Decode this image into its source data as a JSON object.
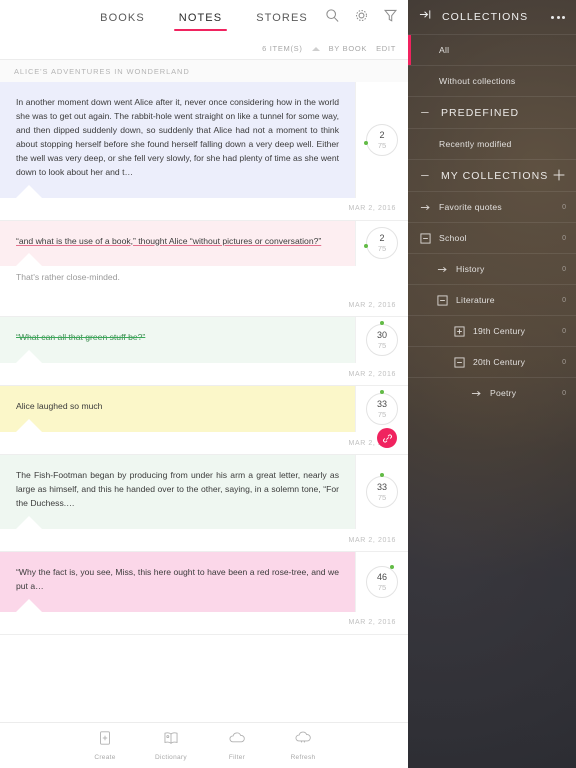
{
  "topnav": {
    "tabs": [
      {
        "label": "BOOKS",
        "active": false
      },
      {
        "label": "NOTES",
        "active": true
      },
      {
        "label": "STORES",
        "active": false
      }
    ],
    "icons": [
      "search-icon",
      "gear-icon",
      "filter-icon"
    ]
  },
  "subbar": {
    "count_label": "6 ITEM(S)",
    "sort_label": "BY BOOK",
    "edit_label": "EDIT"
  },
  "list": {
    "book_title": "ALICE'S ADVENTURES IN WONDERLAND",
    "notes": [
      {
        "text": "In another moment down went Alice after it, never once considering how in the world she was to get out again. The rabbit-hole went straight on like a tunnel for some way, and then dipped suddenly down, so suddenly that Alice had not a moment to think about stopping herself before she found herself falling down a very deep well. Either the well was very deep, or she fell very slowly, for she had plenty of time as she went down to look about her and t…",
        "style": "plain",
        "bg": "#eceefb",
        "accent": "#2b4fd8",
        "page": "2",
        "total": "75",
        "dot": "pos-left",
        "date": "MAR 2, 2016",
        "comment": null,
        "link": false
      },
      {
        "text": "“and what is the use of a book,” thought Alice “without pictures or conversation?”",
        "style": "underline",
        "bg": "#fdeef1",
        "accent": "",
        "page": "2",
        "total": "75",
        "dot": "pos-left",
        "date": "MAR 2, 2016",
        "comment": "That's rather close-minded.",
        "link": false
      },
      {
        "text": "“What can all that green stuff be?”",
        "style": "strike",
        "bg": "#f0f8f2",
        "accent": "",
        "page": "30",
        "total": "75",
        "dot": "pos-top",
        "date": "MAR 2, 2016",
        "comment": null,
        "link": false
      },
      {
        "text": "Alice laughed so much",
        "style": "plain",
        "bg": "#fbf7c9",
        "accent": "",
        "page": "33",
        "total": "75",
        "dot": "pos-top",
        "date": "MAR 2, 2016",
        "comment": null,
        "link": true
      },
      {
        "text": "The Fish-Footman began by producing from under his arm a great letter, nearly as large as himself, and this he handed over to the other, saying, in a solemn tone, “For the Duchess.…",
        "style": "plain",
        "bg": "#eff7f1",
        "accent": "#16a34a",
        "page": "33",
        "total": "75",
        "dot": "pos-top",
        "date": "MAR 2, 2016",
        "comment": null,
        "link": false
      },
      {
        "text": "“Why the fact is, you see, Miss, this here ought to have been a red rose-tree, and we put a…",
        "style": "plain",
        "bg": "#fbd7e9",
        "accent": "",
        "page": "46",
        "total": "75",
        "dot": "pos-tr",
        "date": "MAR 2, 2016",
        "comment": null,
        "link": false
      }
    ]
  },
  "bottombar": {
    "items": [
      {
        "label": "Create",
        "icon": "create-note-icon"
      },
      {
        "label": "Dictionary",
        "icon": "dictionary-icon"
      },
      {
        "label": "Filter",
        "icon": "cloud-icon"
      },
      {
        "label": "Refresh",
        "icon": "cloud-refresh-icon"
      }
    ]
  },
  "sidebar": {
    "title": "COLLECTIONS",
    "collapse_icon": "collapse-panel-icon",
    "more_icon": "more-options-icon",
    "add_icon": "add-collection-icon",
    "rows": [
      {
        "label": "All",
        "type": "plain",
        "selected": true,
        "count": "",
        "indent": 1,
        "icon": ""
      },
      {
        "label": "Without collections",
        "type": "plain",
        "selected": false,
        "count": "",
        "indent": 1,
        "icon": ""
      },
      {
        "label": "PREDEFINED",
        "type": "section",
        "selected": false,
        "count": "",
        "indent": 1,
        "icon": "minus-icon"
      },
      {
        "label": "Recently modified",
        "type": "plain",
        "selected": false,
        "count": "",
        "indent": 1,
        "icon": ""
      },
      {
        "label": "MY COLLECTIONS",
        "type": "section",
        "selected": false,
        "count": "",
        "indent": 1,
        "icon": "minus-icon",
        "add": true
      },
      {
        "label": "Favorite quotes",
        "type": "item",
        "selected": false,
        "count": "0",
        "indent": 1,
        "icon": "arrow-right-icon"
      },
      {
        "label": "School",
        "type": "item",
        "selected": false,
        "count": "0",
        "indent": 1,
        "icon": "collapse-box-icon"
      },
      {
        "label": "History",
        "type": "item",
        "selected": false,
        "count": "0",
        "indent": 2,
        "icon": "arrow-right-icon"
      },
      {
        "label": "Literature",
        "type": "item",
        "selected": false,
        "count": "0",
        "indent": 2,
        "icon": "collapse-box-icon"
      },
      {
        "label": "19th Century",
        "type": "item",
        "selected": false,
        "count": "0",
        "indent": 3,
        "icon": "expand-box-icon"
      },
      {
        "label": "20th Century",
        "type": "item",
        "selected": false,
        "count": "0",
        "indent": 3,
        "icon": "collapse-box-icon"
      },
      {
        "label": "Poetry",
        "type": "item",
        "selected": false,
        "count": "0",
        "indent": 4,
        "icon": "arrow-right-icon"
      }
    ]
  },
  "colors": {
    "accent_pink": "#f0235f",
    "green_dot": "#62bb46"
  }
}
